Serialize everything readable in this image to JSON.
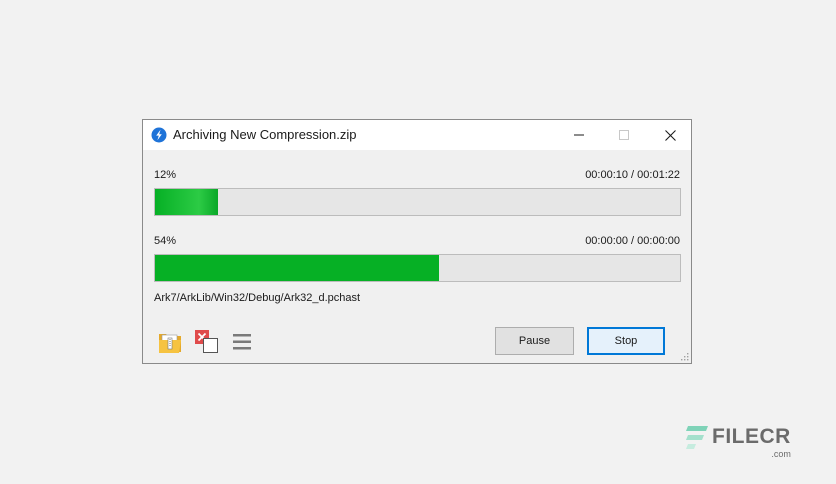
{
  "window": {
    "title": "Archiving New Compression.zip",
    "controls": [
      "minimize",
      "maximize",
      "close"
    ]
  },
  "progress": [
    {
      "percent_label": "12%",
      "time": "00:00:10 / 00:01:22",
      "value": 0.12
    },
    {
      "percent_label": "54%",
      "time": "00:00:00 / 00:00:00",
      "value": 0.54
    }
  ],
  "current_file": "Ark7/ArkLib/Win32/Debug/Ark32_d.pchast",
  "toolbar": {
    "icons": [
      "open-folder-icon",
      "remove-icon",
      "menu-icon"
    ]
  },
  "buttons": {
    "pause_label": "Pause",
    "stop_label": "Stop"
  },
  "watermark": {
    "text": "FILECR",
    "sub": ".com"
  },
  "colors": {
    "progress_fill": "#06b025",
    "accent": "#0078d7",
    "remove_red": "#e04b4b",
    "folder_yellow": "#f6c341"
  }
}
